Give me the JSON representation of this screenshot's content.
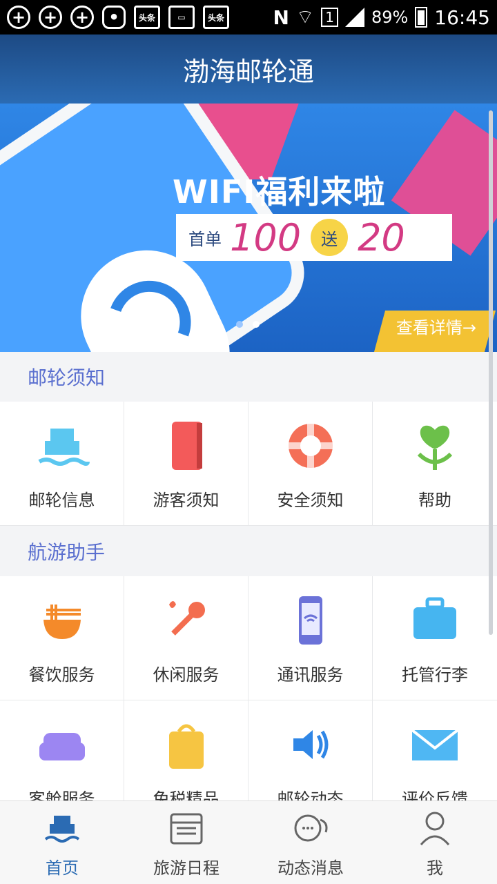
{
  "status": {
    "battery": "89%",
    "time": "16:45",
    "sim_slot": "1",
    "notif_labels": [
      "头条",
      "头条"
    ]
  },
  "app": {
    "title": "渤海邮轮通"
  },
  "banner": {
    "title": "WIFI福利来啦",
    "first_order": "首单",
    "amount": "100",
    "gift": "送",
    "bonus": "20",
    "detail": "查看详情→"
  },
  "sections": [
    {
      "title": "邮轮须知",
      "items": [
        {
          "label": "邮轮信息",
          "icon": "ship-icon",
          "color": "#5bc7f0"
        },
        {
          "label": "游客须知",
          "icon": "book-icon",
          "color": "#f35a5a"
        },
        {
          "label": "安全须知",
          "icon": "lifebuoy-icon",
          "color": "#f46f57"
        },
        {
          "label": "帮助",
          "icon": "plant-heart-icon",
          "color": "#6cc04a"
        }
      ]
    },
    {
      "title": "航游助手",
      "items": [
        {
          "label": "餐饮服务",
          "icon": "noodle-bowl-icon",
          "color": "#f48a2a"
        },
        {
          "label": "休闲服务",
          "icon": "microphone-icon",
          "color": "#f36d4f"
        },
        {
          "label": "通讯服务",
          "icon": "phone-wifi-icon",
          "color": "#6b72d8"
        },
        {
          "label": "托管行李",
          "icon": "suitcase-icon",
          "color": "#46b5f0"
        },
        {
          "label": "客舱服务",
          "icon": "sofa-icon",
          "color": "#9c86f2"
        },
        {
          "label": "免税精品",
          "icon": "shopping-bag-icon",
          "color": "#f6c542"
        },
        {
          "label": "邮轮动态",
          "icon": "speaker-icon",
          "color": "#2f86e6"
        },
        {
          "label": "评价反馈",
          "icon": "mail-icon",
          "color": "#4fb7f3"
        }
      ]
    }
  ],
  "tabs": [
    {
      "label": "首页",
      "icon": "ship-icon",
      "active": true
    },
    {
      "label": "旅游日程",
      "icon": "calendar-icon",
      "active": false
    },
    {
      "label": "动态消息",
      "icon": "chat-icon",
      "active": false
    },
    {
      "label": "我",
      "icon": "user-icon",
      "active": false
    }
  ]
}
